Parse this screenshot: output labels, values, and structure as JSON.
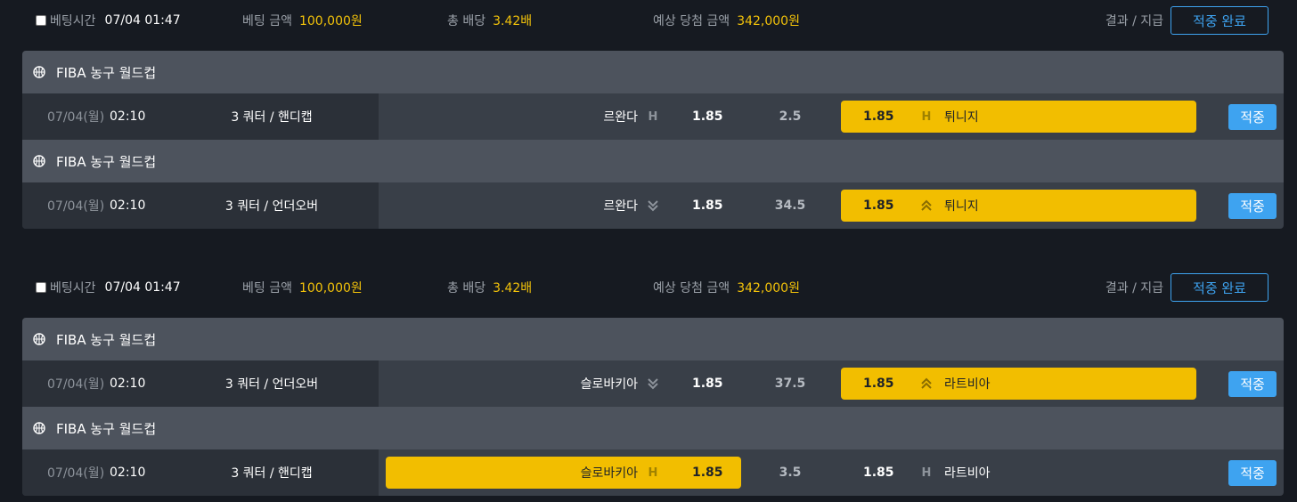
{
  "bets": [
    {
      "header": {
        "bet_time_label": "베팅시간",
        "bet_time_value": "07/04 01:47",
        "amount_label": "베팅 금액",
        "amount_value": "100,000원",
        "odds_label": "총 배당",
        "odds_value": "3.42배",
        "win_label": "예상 당첨 금액",
        "win_value": "342,000원",
        "result_label": "결과 / 지급",
        "status_button": "적중 완료"
      },
      "games": [
        {
          "league": "FIBA 농구 월드컵",
          "date": "07/04(월)",
          "time": "02:10",
          "market": "3 쿼터 / 핸디캡",
          "home_team": "르완다",
          "home_indicator": "handicap",
          "home_odds": "1.85",
          "line": "2.5",
          "away_odds": "1.85",
          "away_indicator": "handicap",
          "away_team": "튀니지",
          "selected": "away",
          "result_button": "적중"
        },
        {
          "league": "FIBA 농구 월드컵",
          "date": "07/04(월)",
          "time": "02:10",
          "market": "3 쿼터 / 언더오버",
          "home_team": "르완다",
          "home_indicator": "under",
          "home_odds": "1.85",
          "line": "34.5",
          "away_odds": "1.85",
          "away_indicator": "over",
          "away_team": "튀니지",
          "selected": "away",
          "result_button": "적중"
        }
      ]
    },
    {
      "header": {
        "bet_time_label": "베팅시간",
        "bet_time_value": "07/04 01:47",
        "amount_label": "베팅 금액",
        "amount_value": "100,000원",
        "odds_label": "총 배당",
        "odds_value": "3.42배",
        "win_label": "예상 당첨 금액",
        "win_value": "342,000원",
        "result_label": "결과 / 지급",
        "status_button": "적중 완료"
      },
      "games": [
        {
          "league": "FIBA 농구 월드컵",
          "date": "07/04(월)",
          "time": "02:10",
          "market": "3 쿼터 / 언더오버",
          "home_team": "슬로바키아",
          "home_indicator": "under",
          "home_odds": "1.85",
          "line": "37.5",
          "away_odds": "1.85",
          "away_indicator": "over",
          "away_team": "라트비아",
          "selected": "away",
          "result_button": "적중"
        },
        {
          "league": "FIBA 농구 월드컵",
          "date": "07/04(월)",
          "time": "02:10",
          "market": "3 쿼터 / 핸디캡",
          "home_team": "슬로바키아",
          "home_indicator": "handicap",
          "home_odds": "1.85",
          "line": "3.5",
          "away_odds": "1.85",
          "away_indicator": "handicap",
          "away_team": "라트비아",
          "selected": "home",
          "result_button": "적중"
        }
      ]
    }
  ],
  "icons": {
    "handicap": "H",
    "under": "double-chevron-down-icon",
    "over": "double-chevron-up-icon",
    "league": "basketball-icon"
  },
  "colors": {
    "background": "#161a21",
    "accent_blue": "#3ea3f0",
    "highlight_yellow": "#f2be00",
    "amount_yellow": "#f2c20a"
  }
}
